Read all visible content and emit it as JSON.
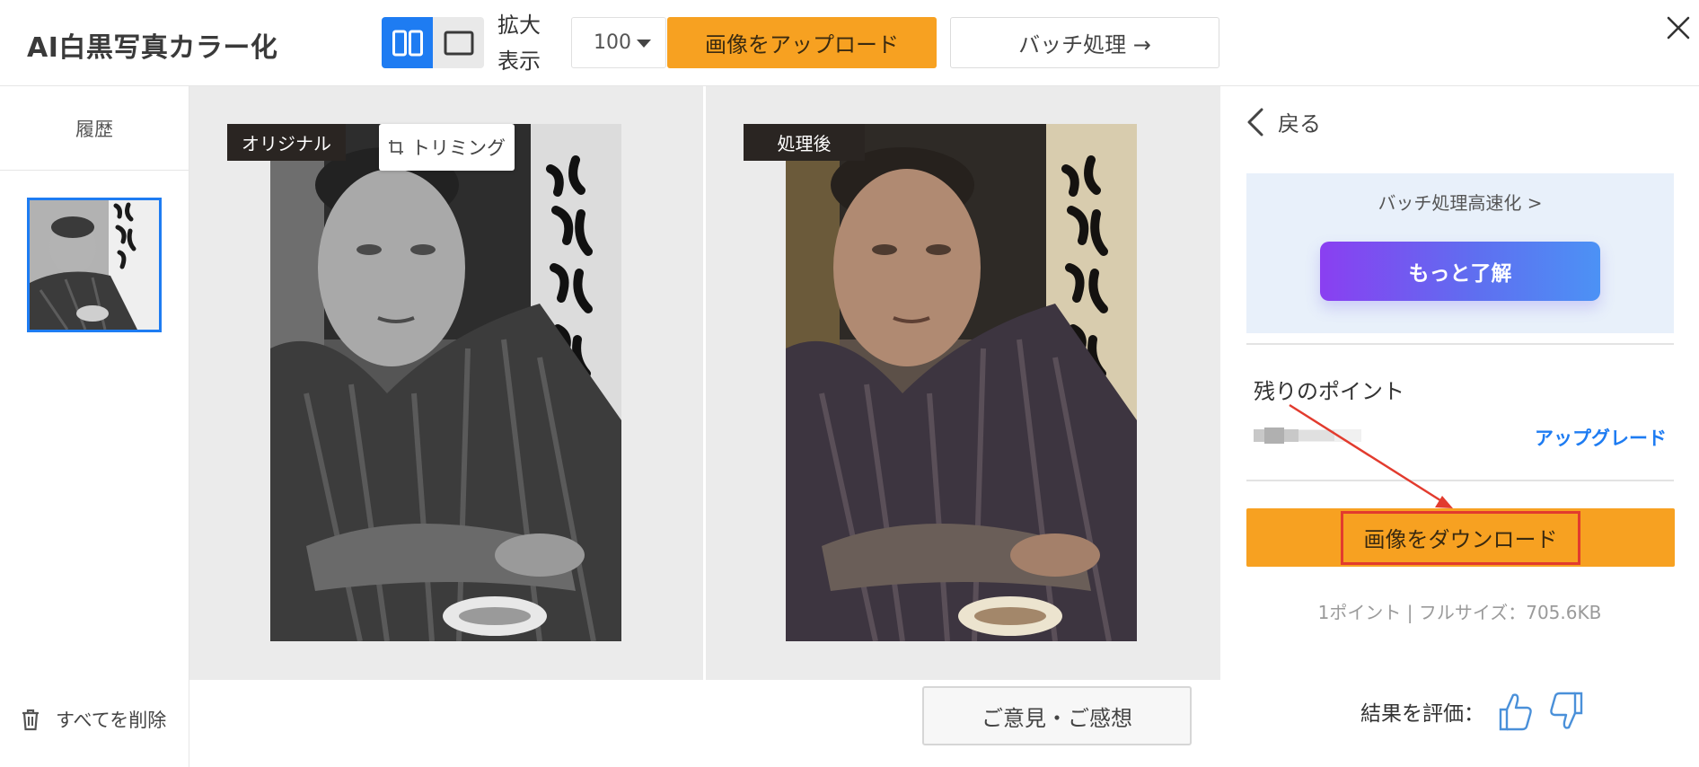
{
  "header": {
    "title": "AI白黒写真カラー化",
    "zoom_label_line1": "拡大",
    "zoom_label_line2": "表示",
    "zoom_value": "100",
    "upload_label": "画像をアップロード",
    "batch_label": "バッチ処理 →"
  },
  "sidebar": {
    "history_title": "履歴",
    "delete_all_label": "すべてを削除"
  },
  "center": {
    "original_label": "オリジナル",
    "processed_label": "処理後",
    "crop_label": "トリミング",
    "feedback_label": "ご意見・ご感想"
  },
  "right_panel": {
    "back_label": "戻る",
    "promo_text": "バッチ処理高速化 >",
    "learn_more_label": "もっと了解",
    "points_label": "残りのポイント",
    "upgrade_label": "アップグレード",
    "download_label": "画像をダウンロード",
    "size_info": "1ポイント | フルサイズ：705.6KB",
    "rate_label": "結果を評価："
  },
  "colors": {
    "accent_blue": "#1e7cf2",
    "orange": "#f7a121",
    "annotation_red": "#e23b2e",
    "gradient_start": "#8a3ff1",
    "gradient_end": "#4c92f5"
  },
  "icons": [
    "split-view-icon",
    "single-view-icon",
    "close-icon",
    "trash-icon",
    "crop-icon",
    "back-chevron-icon",
    "thumbs-up-icon",
    "thumbs-down-icon"
  ]
}
